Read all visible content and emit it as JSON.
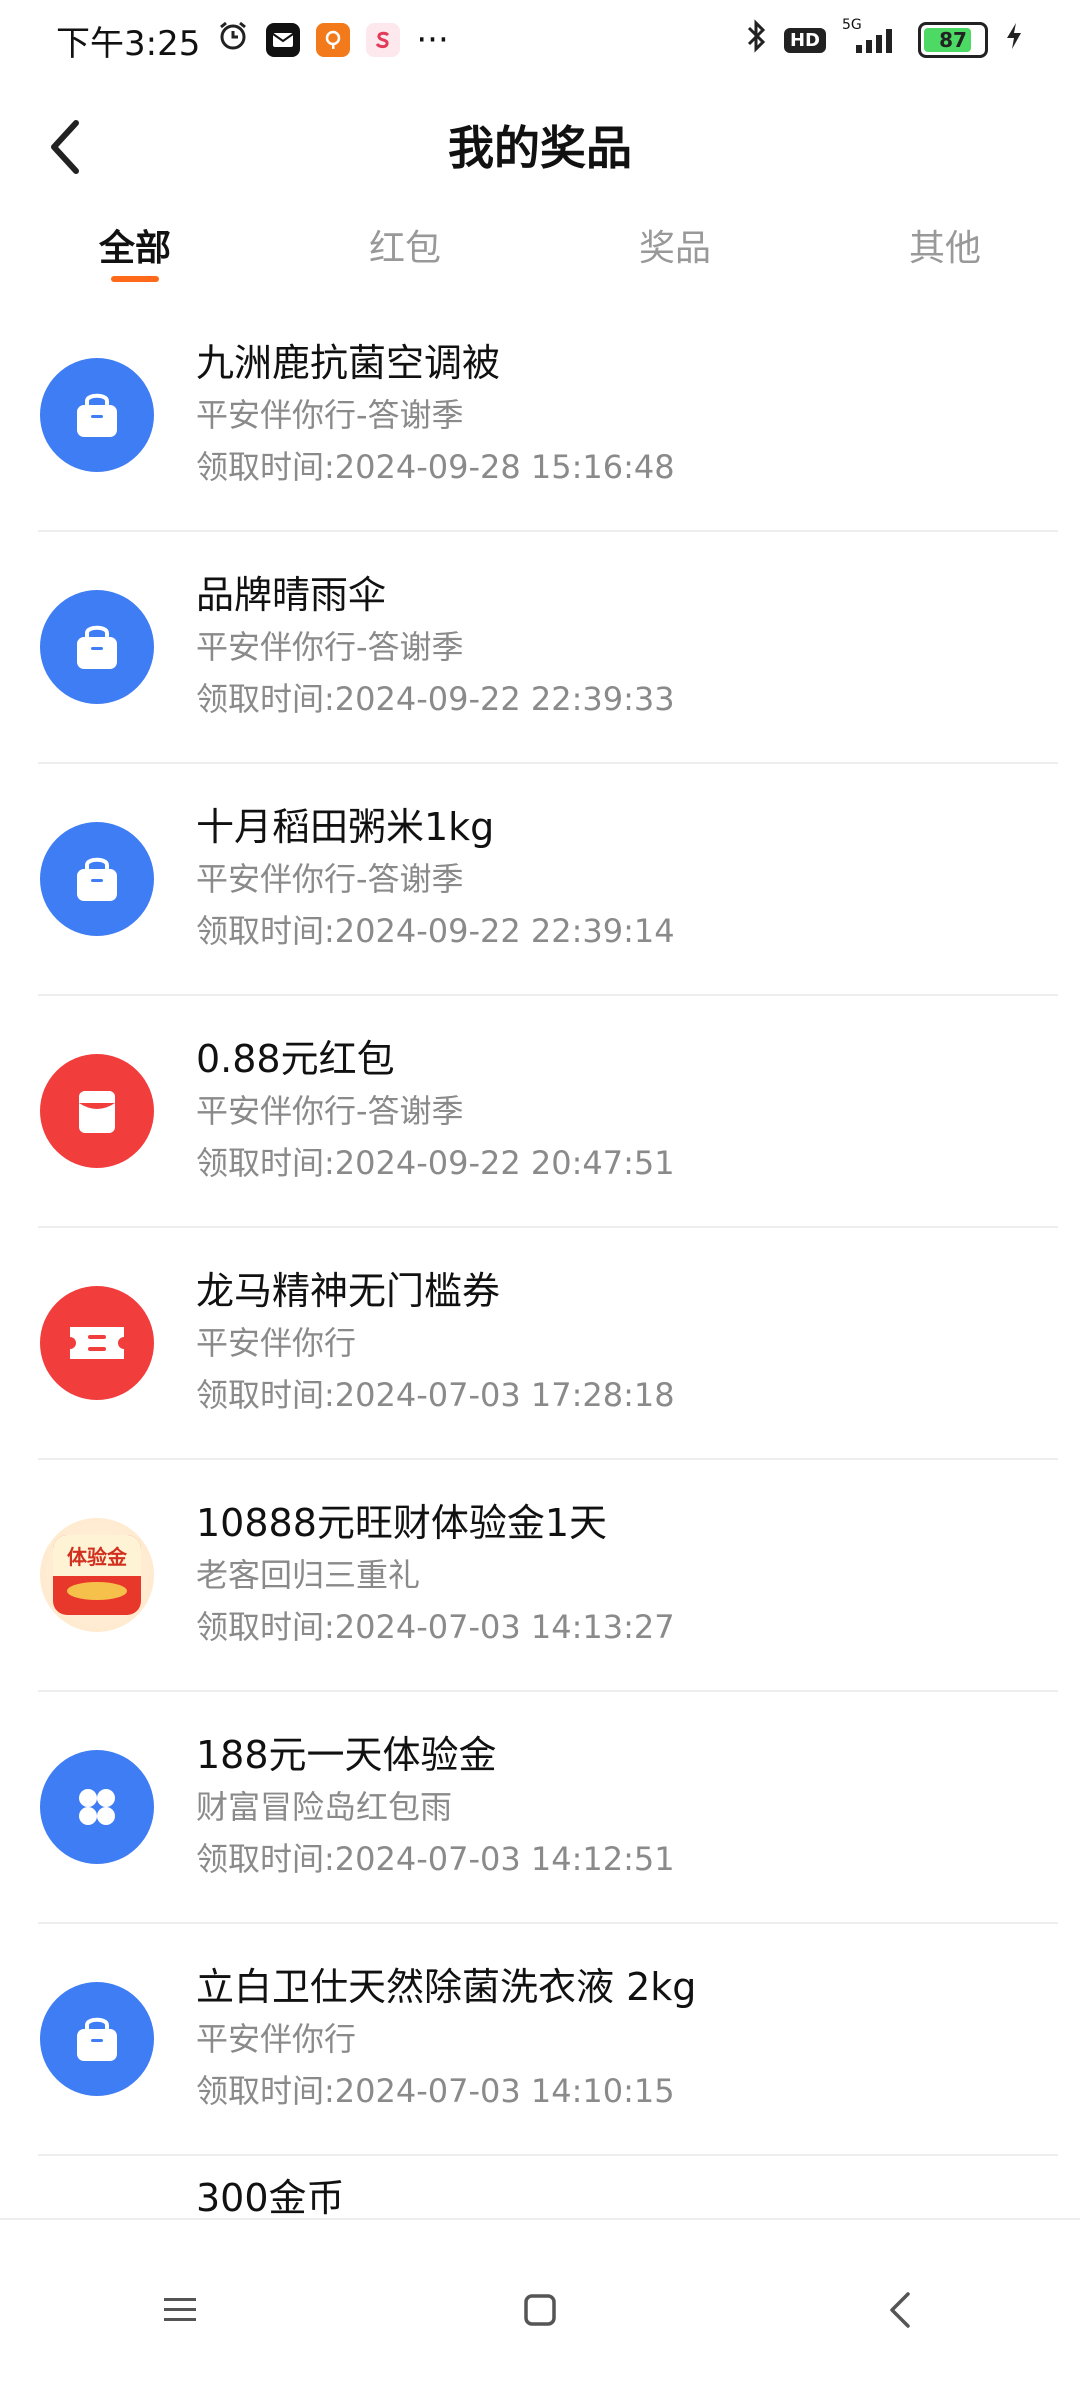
{
  "status_bar": {
    "time": "下午3:25",
    "network": "5G",
    "hd_badge": "HD",
    "battery": "87",
    "more": "···"
  },
  "header": {
    "title": "我的奖品",
    "back_icon": "chevron-left-icon"
  },
  "tabs": [
    {
      "label": "全部",
      "active": true
    },
    {
      "label": "红包",
      "active": false
    },
    {
      "label": "奖品",
      "active": false
    },
    {
      "label": "其他",
      "active": false
    }
  ],
  "prizes": [
    {
      "name": "九洲鹿抗菌空调被",
      "source": "平安伴你行-答谢季",
      "time": "领取时间:2024-09-28 15:16:48",
      "icon": "shopping-bag-icon",
      "color": "#3f7df4"
    },
    {
      "name": "品牌晴雨伞",
      "source": "平安伴你行-答谢季",
      "time": "领取时间:2024-09-22 22:39:33",
      "icon": "shopping-bag-icon",
      "color": "#3f7df4"
    },
    {
      "name": "十月稻田粥米1kg",
      "source": "平安伴你行-答谢季",
      "time": "领取时间:2024-09-22 22:39:14",
      "icon": "shopping-bag-icon",
      "color": "#3f7df4"
    },
    {
      "name": "0.88元红包",
      "source": "平安伴你行-答谢季",
      "time": "领取时间:2024-09-22 20:47:51",
      "icon": "red-envelope-icon",
      "color": "#f23d3d"
    },
    {
      "name": "龙马精神无门槛券",
      "source": "平安伴你行",
      "time": "领取时间:2024-07-03 17:28:18",
      "icon": "coupon-ticket-icon",
      "color": "#f23d3d"
    },
    {
      "name": "10888元旺财体验金1天",
      "source": "老客回归三重礼",
      "time": "领取时间:2024-07-03 14:13:27",
      "icon": "trial-gold-icon",
      "color": "#ffe7c9",
      "badge_text": "体验金"
    },
    {
      "name": "188元一天体验金",
      "source": "财富冒险岛红包雨",
      "time": "领取时间:2024-07-03 14:12:51",
      "icon": "four-petal-icon",
      "color": "#3f7df4"
    },
    {
      "name": "立白卫仕天然除菌洗衣液 2kg",
      "source": "平安伴你行",
      "time": "领取时间:2024-07-03 14:10:15",
      "icon": "shopping-bag-icon",
      "color": "#3f7df4"
    },
    {
      "name": "300金币",
      "source": "",
      "time": "",
      "icon": "coin-icon",
      "color": "#3f7df4"
    }
  ],
  "nav": {
    "menu_icon": "menu-icon",
    "home_icon": "home-square-icon",
    "back_icon": "back-triangle-icon"
  }
}
